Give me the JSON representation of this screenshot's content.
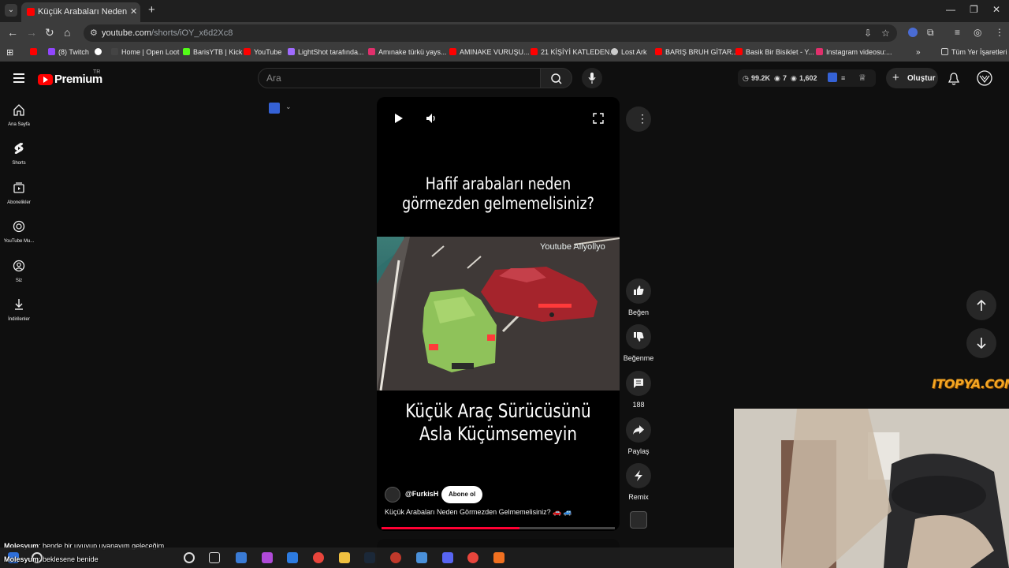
{
  "browser": {
    "tab_title": "Küçük Arabaları Neden Görmezden Gelmemelisiniz?",
    "url_host": "youtube.com",
    "url_path": "/shorts/iOY_x6d2Xc8",
    "bookmarks": [
      {
        "label": "",
        "color": "#ff0000"
      },
      {
        "label": "(8) Twitch",
        "color": "#9146ff"
      },
      {
        "label": "",
        "color": "#ffffff"
      },
      {
        "label": "Home | Open Loot",
        "color": "#444444"
      },
      {
        "label": "BarisYTB | Kick",
        "color": "#53fc18"
      },
      {
        "label": "YouTube",
        "color": "#ff0000"
      },
      {
        "label": "LightShot tarafında...",
        "color": "#a06bff"
      },
      {
        "label": "Amınake türkü yays...",
        "color": "#e1306c"
      },
      {
        "label": "AMINAKE VURUŞU...",
        "color": "#ff0000"
      },
      {
        "label": "21 KİŞİYİ KATLEDEN...",
        "color": "#ff0000"
      },
      {
        "label": "Lost Ark",
        "color": "#cccccc"
      },
      {
        "label": "BARIŞ BRUH GİTAR...",
        "color": "#ff0000"
      },
      {
        "label": "Basik Bir Bisiklet - Y...",
        "color": "#ff0000"
      },
      {
        "label": "Instagram videosu:...",
        "color": "#e1306c"
      }
    ],
    "all_bookmarks": "Tüm Yer İşaretleri"
  },
  "yt": {
    "logo_text": "Premium",
    "country": "TR",
    "search_placeholder": "Ara",
    "stats": {
      "views": "99.2K",
      "visible": "7",
      "eyes": "1,602"
    },
    "create_label": "Oluştur"
  },
  "sidebar": [
    {
      "label": "Ana Sayfa",
      "icon": "home-icon"
    },
    {
      "label": "Shorts",
      "icon": "shorts-icon"
    },
    {
      "label": "Abonelikler",
      "icon": "subscriptions-icon"
    },
    {
      "label": "YouTube Mu...",
      "icon": "youtube-music-icon"
    },
    {
      "label": "Siz",
      "icon": "you-icon"
    },
    {
      "label": "İndirilenler",
      "icon": "downloads-icon"
    }
  ],
  "video": {
    "heading_top": "Hafif arabaları neden görmezden gelmemelisiniz?",
    "heading_bottom": "Küçük Araç Sürücüsünü Asla Küçümsemeyin",
    "watermark": "Youtube Allyollyo",
    "channel": "@FurkisH",
    "subscribe": "Abone ol",
    "caption": "Küçük Arabaları Neden Görmezden Gelmemelisiniz? 🚗 🚙",
    "progress": 0.59
  },
  "actions": {
    "like": "Beğen",
    "dislike": "Beğenme",
    "comments": "188",
    "share": "Paylaş",
    "remix": "Remix"
  },
  "overlay": {
    "sponsor": "ITOPYA.COM",
    "chat": [
      {
        "user": "Molesyum",
        "text": ": bende bir uyuyup uyanayım geleceğim"
      },
      {
        "user": "Molesyum",
        "text": ": beklesene benide"
      }
    ]
  }
}
